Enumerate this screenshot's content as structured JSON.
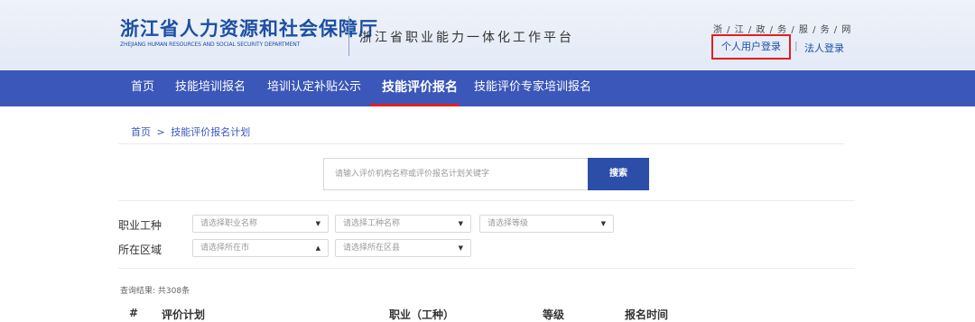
{
  "header": {
    "org_name": "浙江省人力资源和社会保障厅",
    "org_name_en": "ZHEJIANG HUMAN RESOURCES AND SOCIAL SECURITY DEPARTMENT",
    "platform_name": "浙江省职业能力一体化工作平台",
    "gov_service": "浙 / 江 / 政 / 务 / 服 / 务 / 网",
    "login_personal": "个人用户登录",
    "login_separator": "|",
    "login_legal": "法人登录"
  },
  "nav": {
    "items": [
      "首页",
      "技能培训报名",
      "培训认定补贴公示",
      "技能评价报名",
      "技能评价专家培训报名"
    ],
    "active_index": 3
  },
  "breadcrumb": {
    "home": "首页",
    "separator": ">",
    "current": "技能评价报名计划"
  },
  "search": {
    "placeholder": "请输入评价机构名称或评价报名计划关键字",
    "button_label": "搜索"
  },
  "filters": {
    "occupation_label": "职业工种",
    "region_label": "所在区域",
    "occupation_placeholder": "请选择职业名称",
    "worktype_placeholder": "请选择工种名称",
    "level_placeholder": "请选择等级",
    "city_placeholder": "请选择所在市",
    "district_placeholder": "请选择所在区县"
  },
  "results": {
    "count_text": "查询结果: 共308条",
    "columns": [
      "#",
      "评价计划",
      "职业（工种）",
      "等级",
      "报名时间"
    ]
  },
  "colors": {
    "brand_blue": "#1d4fa3",
    "nav_bg": "#3b57b9",
    "search_button": "#2d4ea8",
    "highlight_red": "#e02020"
  }
}
